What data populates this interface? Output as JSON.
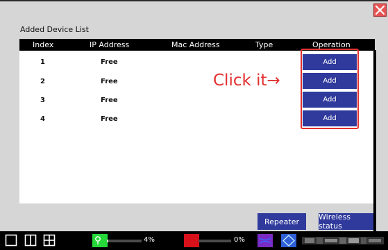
{
  "window": {
    "close_icon": "close-x-icon"
  },
  "device_list": {
    "title": "Added Device List",
    "columns": [
      "Index",
      "IP Address",
      "Mac Address",
      "Type",
      "Operation"
    ],
    "rows": [
      {
        "index": "1",
        "ip": "Free",
        "mac": "",
        "type": "",
        "operation": "Add"
      },
      {
        "index": "2",
        "ip": "Free",
        "mac": "",
        "type": "",
        "operation": "Add"
      },
      {
        "index": "3",
        "ip": "Free",
        "mac": "",
        "type": "",
        "operation": "Add"
      },
      {
        "index": "4",
        "ip": "Free",
        "mac": "",
        "type": "",
        "operation": "Add"
      }
    ]
  },
  "annotation": {
    "text": "Click it→",
    "color": "#e33030"
  },
  "actions": {
    "repeater_label": "Repeater",
    "wireless_label": "Wireless status"
  },
  "taskbar": {
    "icons": [
      "single-view-icon",
      "split-2-view-icon",
      "split-4-view-icon"
    ],
    "status1": {
      "color": "#27d83a",
      "icon": "location-pin-icon",
      "percent": 4,
      "label": "4%"
    },
    "status2": {
      "color": "#d8101a",
      "percent": 0,
      "label": "0%"
    },
    "status3": {
      "color": "#7a2bc4",
      "icon": "signal-wave-icon"
    },
    "status4": {
      "color": "#2f5fd6",
      "icon": "diamond-ring-icon"
    }
  },
  "colors": {
    "accent_button": "#2f3a9c",
    "panel_bg": "#d6d6d6",
    "header_bg": "#000000"
  }
}
